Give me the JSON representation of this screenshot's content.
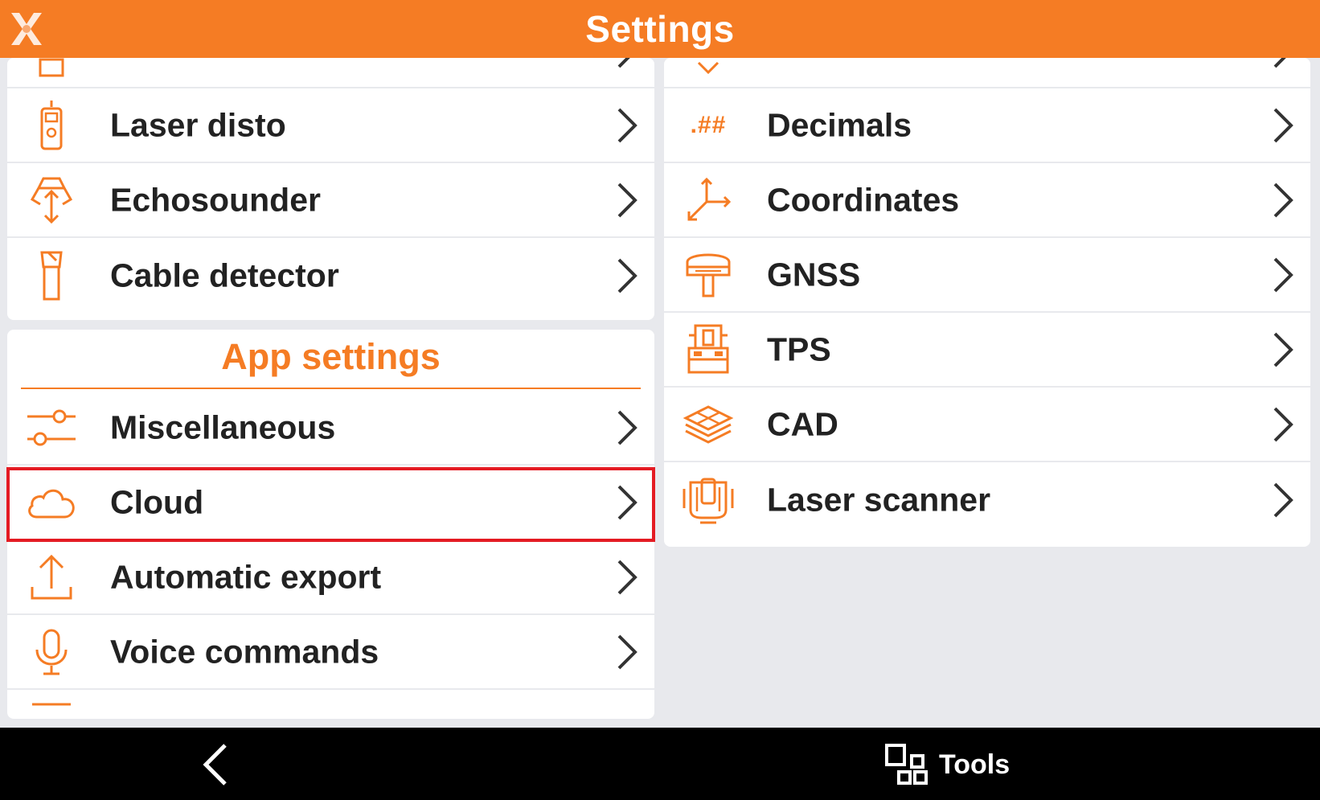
{
  "header": {
    "title": "Settings",
    "logo_letter": "X"
  },
  "left_card_top": {
    "items": [
      {
        "label": "Laser disto",
        "icon": "laser-disto-icon"
      },
      {
        "label": "Echosounder",
        "icon": "echosounder-icon"
      },
      {
        "label": "Cable detector",
        "icon": "cable-detector-icon"
      }
    ]
  },
  "app_settings": {
    "title": "App settings",
    "items": [
      {
        "label": "Miscellaneous",
        "icon": "sliders-icon"
      },
      {
        "label": "Cloud",
        "icon": "cloud-icon",
        "highlighted": true
      },
      {
        "label": "Automatic export",
        "icon": "upload-icon"
      },
      {
        "label": "Voice commands",
        "icon": "microphone-icon"
      }
    ]
  },
  "right_card": {
    "items": [
      {
        "label": "Decimals",
        "icon": "decimals-icon"
      },
      {
        "label": "Coordinates",
        "icon": "axes-icon"
      },
      {
        "label": "GNSS",
        "icon": "gnss-antenna-icon"
      },
      {
        "label": "TPS",
        "icon": "total-station-icon"
      },
      {
        "label": "CAD",
        "icon": "layers-icon"
      },
      {
        "label": "Laser scanner",
        "icon": "laser-scanner-icon"
      }
    ],
    "decimals_glyph": ".##"
  },
  "bottom_bar": {
    "tools_label": "Tools"
  },
  "colors": {
    "accent": "#f57c24",
    "highlight": "#e41b23",
    "background": "#e8e9ed",
    "bottom_bar": "#000000"
  }
}
